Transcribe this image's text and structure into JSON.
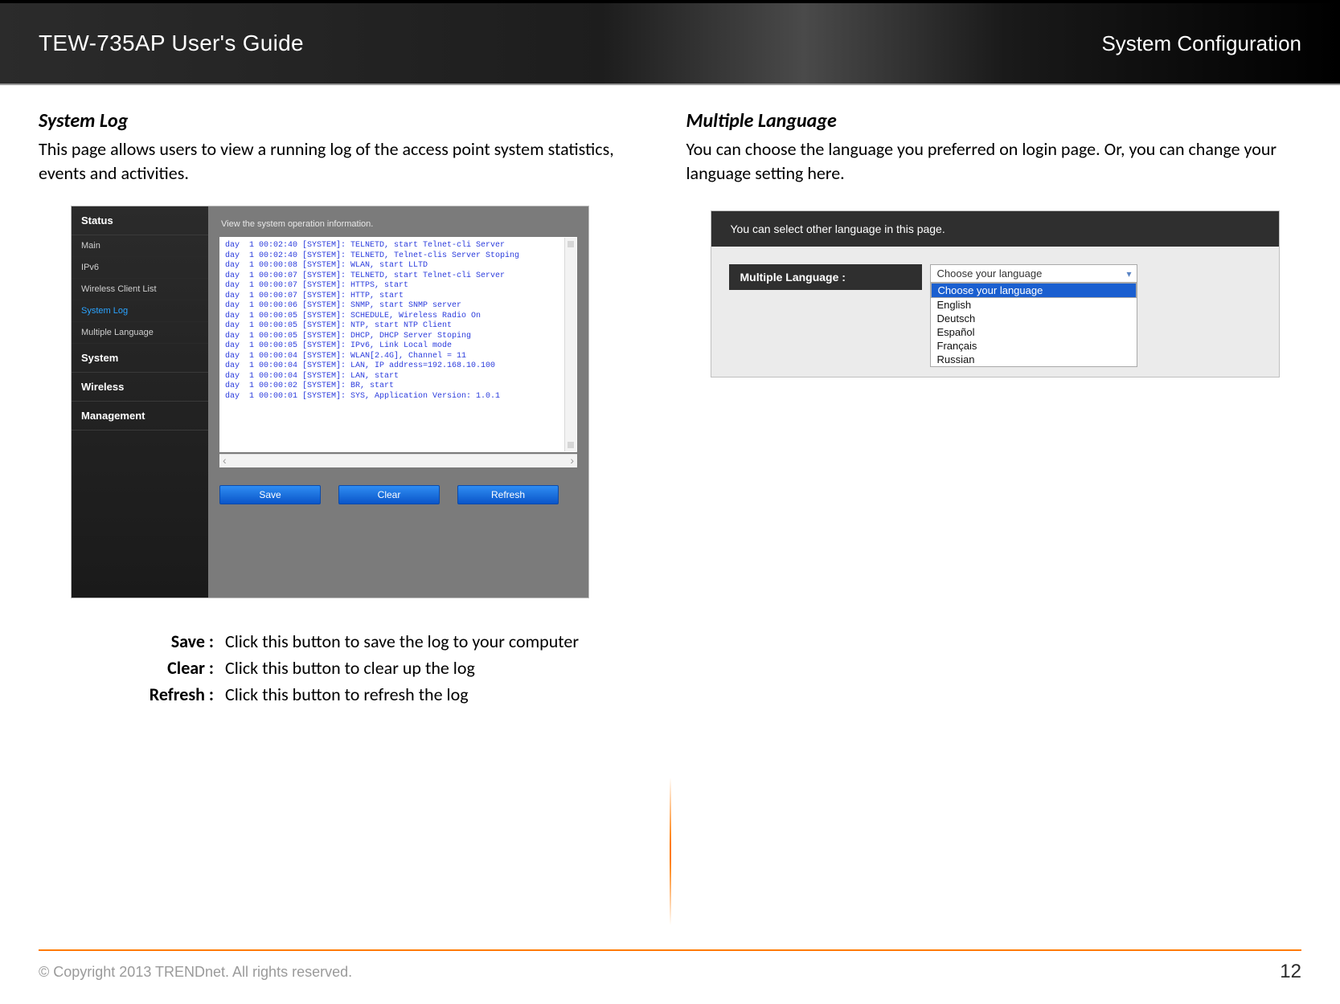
{
  "banner": {
    "left": "TEW-735AP User's Guide",
    "right": "System Configuration"
  },
  "left": {
    "title": "System Log",
    "desc": "This page allows users to view a running log of the access point system statistics, events and activities.",
    "sidebar": {
      "groups": [
        "Status",
        "System",
        "Wireless",
        "Management"
      ],
      "items": [
        "Main",
        "IPv6",
        "Wireless Client List",
        "System Log",
        "Multiple Language"
      ],
      "active_index": 3
    },
    "hint": "View the system operation information.",
    "log": "day  1 00:02:40 [SYSTEM]: TELNETD, start Telnet-cli Server\nday  1 00:02:40 [SYSTEM]: TELNETD, Telnet-clis Server Stoping\nday  1 00:00:08 [SYSTEM]: WLAN, start LLTD\nday  1 00:00:07 [SYSTEM]: TELNETD, start Telnet-cli Server\nday  1 00:00:07 [SYSTEM]: HTTPS, start\nday  1 00:00:07 [SYSTEM]: HTTP, start\nday  1 00:00:06 [SYSTEM]: SNMP, start SNMP server\nday  1 00:00:05 [SYSTEM]: SCHEDULE, Wireless Radio On\nday  1 00:00:05 [SYSTEM]: NTP, start NTP Client\nday  1 00:00:05 [SYSTEM]: DHCP, DHCP Server Stoping\nday  1 00:00:05 [SYSTEM]: IPv6, Link Local mode\nday  1 00:00:04 [SYSTEM]: WLAN[2.4G], Channel = 11\nday  1 00:00:04 [SYSTEM]: LAN, IP address=192.168.10.100\nday  1 00:00:04 [SYSTEM]: LAN, start\nday  1 00:00:02 [SYSTEM]: BR, start\nday  1 00:00:01 [SYSTEM]: SYS, Application Version: 1.0.1",
    "buttons": {
      "save": "Save",
      "clear": "Clear",
      "refresh": "Refresh"
    },
    "table": [
      {
        "label": "Save",
        "text": "Click this button to save the log to your computer"
      },
      {
        "label": "Clear",
        "text": "Click this button to clear up the log"
      },
      {
        "label": "Refresh",
        "text": "Click this button to refresh the log"
      }
    ]
  },
  "right": {
    "title": "Multiple Language",
    "desc": "You can choose the language you preferred on login page. Or, you can change your language setting here.",
    "bar": "You can select other language in this page.",
    "field_label": "Multiple Language :",
    "selected": "Choose your language",
    "options": [
      "Choose your language",
      "English",
      "Deutsch",
      "Español",
      "Français",
      "Russian"
    ],
    "selected_index": 0
  },
  "footer": {
    "copyright": "© Copyright 2013 TRENDnet.  All rights reserved.",
    "page": "12"
  }
}
